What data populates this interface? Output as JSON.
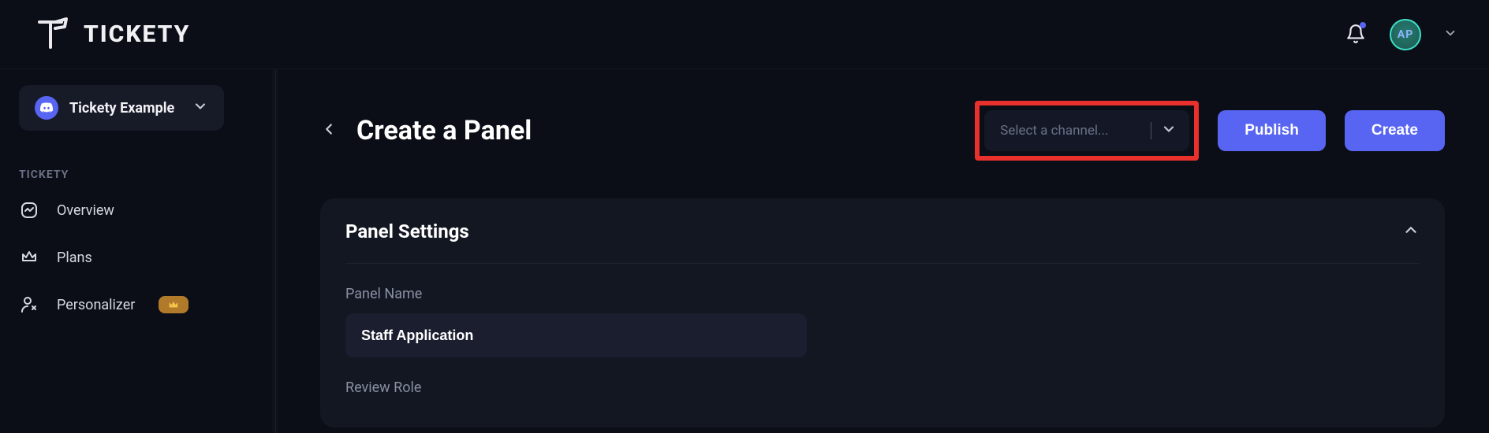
{
  "brand": {
    "name": "TICKETY"
  },
  "topbar": {
    "avatar_initials": "AP"
  },
  "sidebar": {
    "server_name": "Tickety Example",
    "section_label": "TICKETY",
    "items": [
      {
        "label": "Overview"
      },
      {
        "label": "Plans"
      },
      {
        "label": "Personalizer"
      }
    ]
  },
  "page": {
    "title": "Create a Panel",
    "channel_select_placeholder": "Select a channel...",
    "publish_label": "Publish",
    "create_label": "Create"
  },
  "panel_settings": {
    "section_title": "Panel Settings",
    "panel_name_label": "Panel Name",
    "panel_name_value": "Staff Application",
    "review_role_label": "Review Role"
  }
}
